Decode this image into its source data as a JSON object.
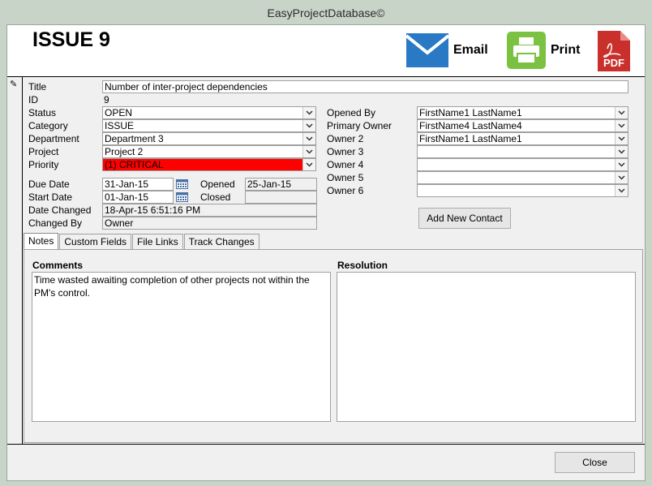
{
  "window": {
    "title": "EasyProjectDatabase©"
  },
  "header": {
    "record_title": "ISSUE 9",
    "email_label": "Email",
    "print_label": "Print",
    "pdf_label": "PDF"
  },
  "record_selector": {
    "icon": "pencil-icon"
  },
  "fields": {
    "title": {
      "label": "Title",
      "value": "Number of inter-project dependencies"
    },
    "id": {
      "label": "ID",
      "value": "9"
    },
    "status": {
      "label": "Status",
      "value": "OPEN"
    },
    "category": {
      "label": "Category",
      "value": "ISSUE"
    },
    "department": {
      "label": "Department",
      "value": "Department 3"
    },
    "project": {
      "label": "Project",
      "value": "Project 2"
    },
    "priority": {
      "label": "Priority",
      "value": "(1) CRITICAL",
      "color": "#ff0000"
    },
    "due_date": {
      "label": "Due Date",
      "value": "31-Jan-15"
    },
    "start_date": {
      "label": "Start Date",
      "value": "01-Jan-15"
    },
    "opened": {
      "label": "Opened",
      "value": "25-Jan-15"
    },
    "closed": {
      "label": "Closed",
      "value": ""
    },
    "date_changed": {
      "label": "Date Changed",
      "value": "18-Apr-15 6:51:16 PM"
    },
    "changed_by": {
      "label": "Changed By",
      "value": "Owner"
    },
    "opened_by": {
      "label": "Opened By",
      "value": "FirstName1 LastName1"
    },
    "primary_owner": {
      "label": "Primary Owner",
      "value": "FirstName4 LastName4"
    },
    "owner2": {
      "label": "Owner 2",
      "value": "FirstName1 LastName1"
    },
    "owner3": {
      "label": "Owner 3",
      "value": ""
    },
    "owner4": {
      "label": "Owner 4",
      "value": ""
    },
    "owner5": {
      "label": "Owner 5",
      "value": ""
    },
    "owner6": {
      "label": "Owner 6",
      "value": ""
    }
  },
  "buttons": {
    "add_contact": "Add New Contact",
    "close": "Close"
  },
  "tabs": [
    {
      "label": "Notes",
      "active": true
    },
    {
      "label": "Custom Fields",
      "active": false
    },
    {
      "label": "File Links",
      "active": false
    },
    {
      "label": "Track Changes",
      "active": false
    }
  ],
  "notes": {
    "comments_label": "Comments",
    "comments_value": "Time wasted awaiting completion of other projects not within the PM's control.",
    "resolution_label": "Resolution",
    "resolution_value": ""
  },
  "colors": {
    "email_blue": "#2a79c4",
    "print_green": "#7cc242",
    "pdf_red": "#c9302c",
    "priority_red": "#ff0000"
  }
}
